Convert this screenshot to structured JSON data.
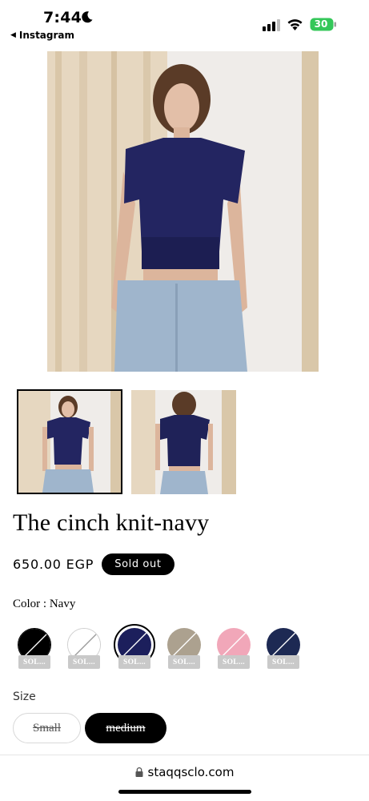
{
  "status_bar": {
    "time": "7:44",
    "back_app": "Instagram",
    "battery": "30"
  },
  "product": {
    "title": "The cinch knit-navy",
    "price": "650.00 EGP",
    "badge": "Sold out",
    "color_label": "Color : Navy",
    "size_label": "Size"
  },
  "swatches": [
    {
      "color": "#000000",
      "tag": "SOL..."
    },
    {
      "color": "#ffffff",
      "tag": "SOL..."
    },
    {
      "color": "#1c1f5c",
      "tag": "SOL..."
    },
    {
      "color": "#aca18f",
      "tag": "SOL..."
    },
    {
      "color": "#f1a7b9",
      "tag": "SOL..."
    },
    {
      "color": "#1d2953",
      "tag": "SOL..."
    }
  ],
  "sizes": [
    "Small",
    "medium"
  ],
  "browser": {
    "url": "staqqsclo.com"
  }
}
